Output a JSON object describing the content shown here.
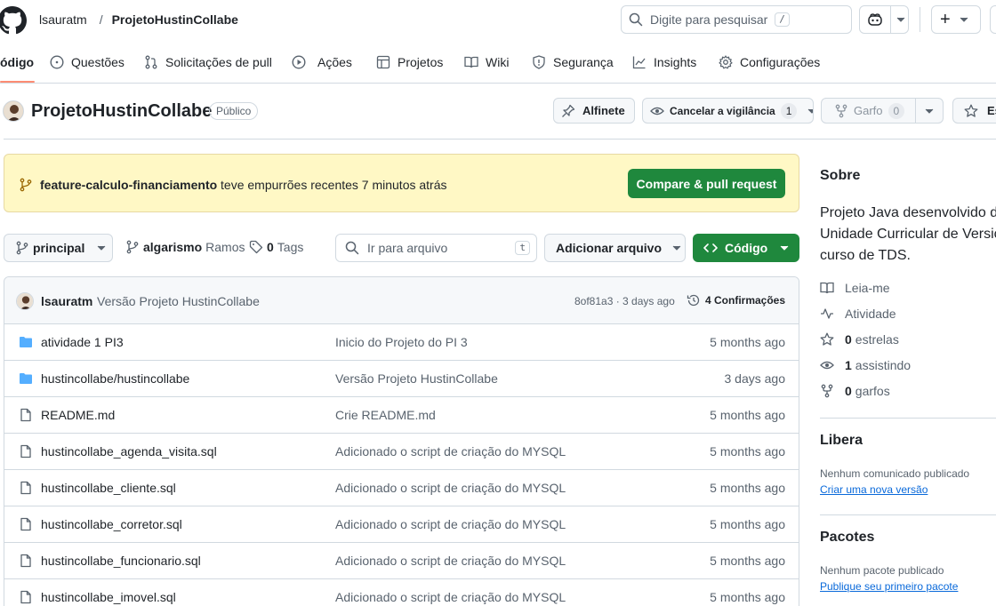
{
  "header": {
    "owner": "lsauratm",
    "separator": "/",
    "repo": "ProjetoHustinCollabe",
    "search_placeholder": "Digite para pesquisar",
    "search_key": "/",
    "plus": "+"
  },
  "nav": {
    "items": [
      {
        "label": "ódigo",
        "icon": "code-icon"
      },
      {
        "label": "Questões",
        "icon": "issue-icon"
      },
      {
        "label": "Solicitações de pull",
        "icon": "pull-request-icon"
      },
      {
        "label": "Ações",
        "icon": "play-icon"
      },
      {
        "label": "Projetos",
        "icon": "table-icon"
      },
      {
        "label": "Wiki",
        "icon": "book-icon"
      },
      {
        "label": "Segurança",
        "icon": "shield-icon"
      },
      {
        "label": "Insights",
        "icon": "graph-icon"
      },
      {
        "label": "Configurações",
        "icon": "gear-icon"
      }
    ]
  },
  "repo_header": {
    "title": "ProjetoHustinCollabe",
    "visibility": "Público",
    "pin_label": "Alfinete",
    "watch_label": "Cancelar a vigilância",
    "watch_count": "1",
    "fork_label": "Garfo",
    "fork_count": "0",
    "star_label": "Es"
  },
  "banner": {
    "branch": "feature-calculo-financiamento",
    "text": "teve empurrões recentes 7 minutos atrás",
    "button": "Compare & pull request",
    "bg_color": "#fff8c5",
    "button_color": "#1f883d"
  },
  "toolbar": {
    "branch_label": "principal",
    "branches_count": "algarismo",
    "branches_label": "Ramos",
    "tags_count": "0",
    "tags_label": "Tags",
    "file_search_placeholder": "Ir para arquivo",
    "file_search_key": "t",
    "add_file": "Adicionar arquivo",
    "code_button": "Código"
  },
  "commit": {
    "author": "lsauratm",
    "message": "Versão Projeto HustinCollabe",
    "hash_time": "8of81a3 · 3 days ago",
    "commits": "4 Confirmações"
  },
  "files": [
    {
      "type": "folder",
      "name": "atividade 1 PI3",
      "message": "Inicio do Projeto do PI 3",
      "time": "5 months ago"
    },
    {
      "type": "folder",
      "name": "hustincollabe/hustincollabe",
      "message": "Versão Projeto HustinCollabe",
      "time": "3 days ago"
    },
    {
      "type": "file",
      "name": "README.md",
      "message": "Crie README.md",
      "time": "5 months ago"
    },
    {
      "type": "file",
      "name": "hustincollabe_agenda_visita.sql",
      "message": "Adicionado o script de criação do MYSQL",
      "time": "5 months ago"
    },
    {
      "type": "file",
      "name": "hustincollabe_cliente.sql",
      "message": "Adicionado o script de criação do MYSQL",
      "time": "5 months ago"
    },
    {
      "type": "file",
      "name": "hustincollabe_corretor.sql",
      "message": "Adicionado o script de criação do MYSQL",
      "time": "5 months ago"
    },
    {
      "type": "file",
      "name": "hustincollabe_funcionario.sql",
      "message": "Adicionado o script de criação do MYSQL",
      "time": "5 months ago"
    },
    {
      "type": "file",
      "name": "hustincollabe_imovel.sql",
      "message": "Adicionado o script de criação do MYSQL",
      "time": "5 months ago"
    }
  ],
  "sidebar": {
    "about_title": "Sobre",
    "about_lines": [
      "Projeto Java desenvolvido d",
      "Unidade Curricular de Versic",
      "curso de TDS."
    ],
    "readme": "Leia-me",
    "activity": "Atividade",
    "stars_count": "0",
    "stars_label": "estrelas",
    "watchers_count": "1",
    "watchers_label": "assistindo",
    "forks_count": "0",
    "forks_label": "garfos",
    "releases_title": "Libera",
    "releases_text": "Nenhum comunicado publicado",
    "releases_link": "Criar uma nova versão",
    "packages_title": "Pacotes",
    "packages_text": "Nenhum pacote publicado",
    "packages_link": "Publique seu primeiro pacote"
  }
}
